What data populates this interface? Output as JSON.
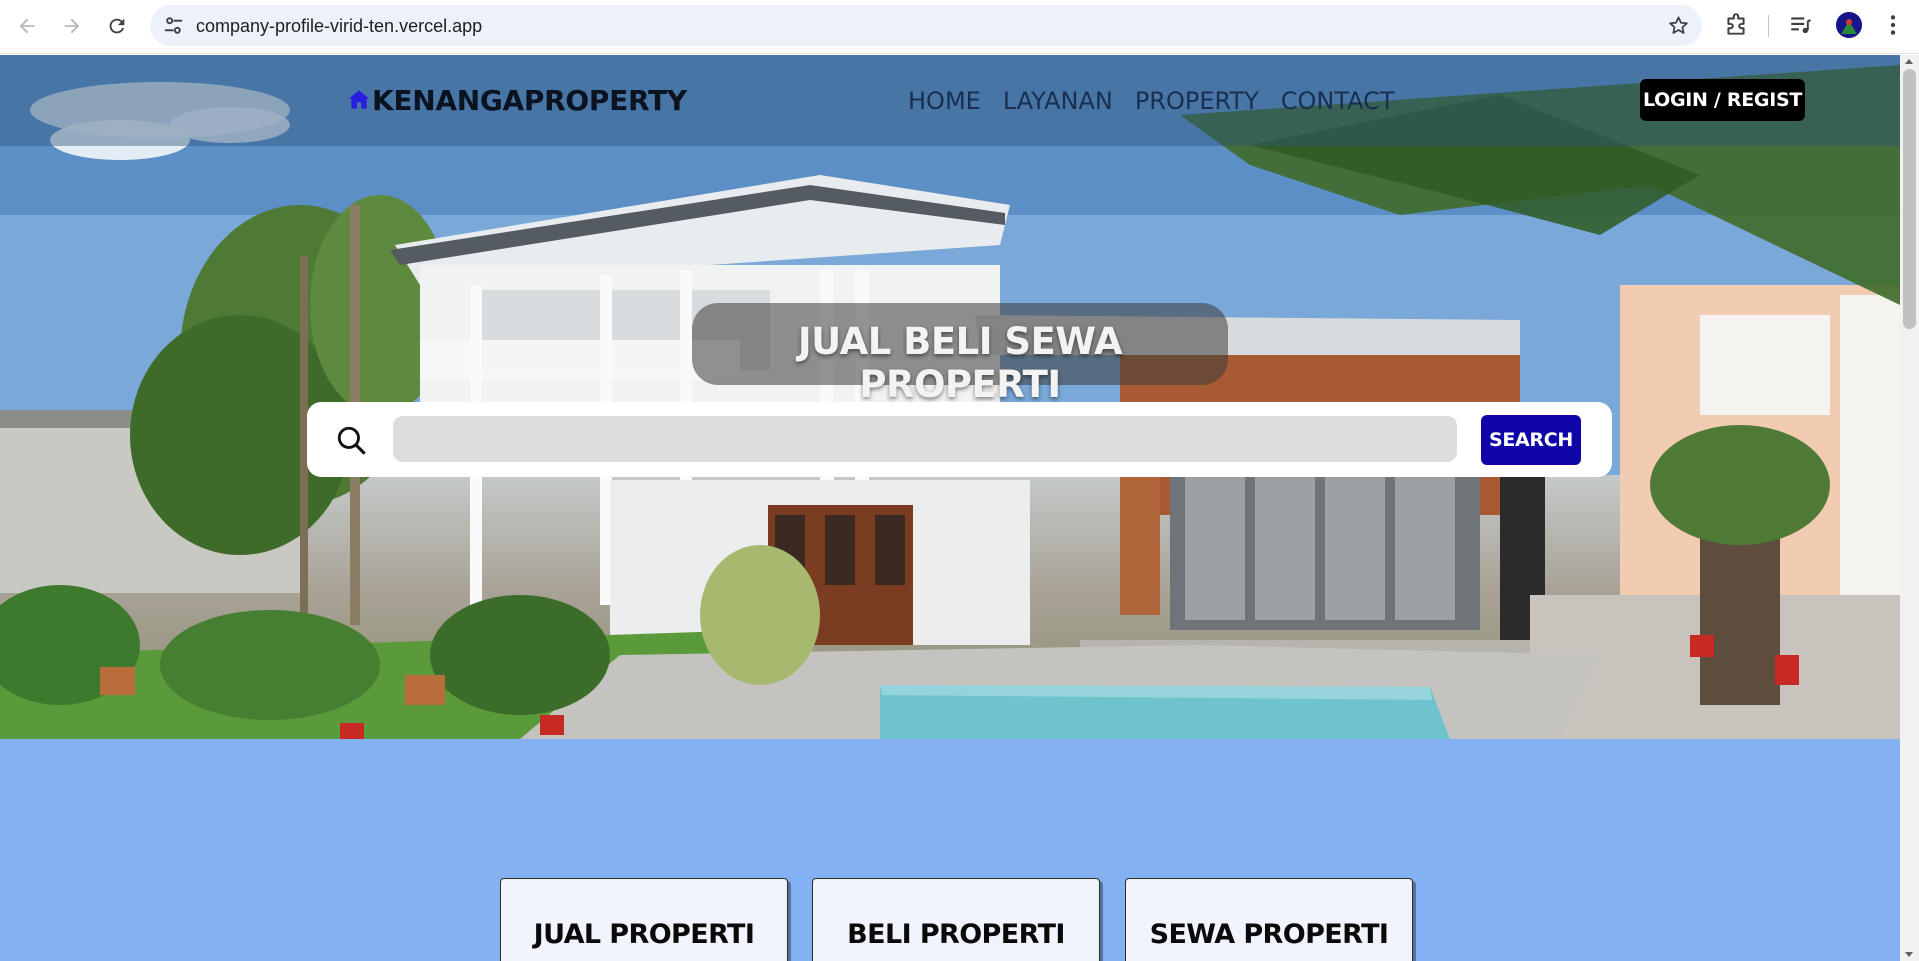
{
  "browser": {
    "url": "company-profile-virid-ten.vercel.app"
  },
  "navbar": {
    "brand": "KENANGAPROPERTY",
    "menu": [
      "HOME",
      "LAYANAN",
      "PROPERTY",
      "CONTACT"
    ],
    "login_label": "LOGIN / REGIST"
  },
  "hero": {
    "title": "JUAL BELI SEWA PROPERTI",
    "search_placeholder": "",
    "search_button": "SEARCH"
  },
  "services": [
    {
      "label": "JUAL PROPERTI"
    },
    {
      "label": "BELI PROPERTI"
    },
    {
      "label": "SEWA PROPERTI"
    }
  ],
  "colors": {
    "navbar_overlay": "#28507a",
    "search_button": "#1005a6",
    "login_button": "#000000",
    "services_bg": "#83b1f2",
    "card_bg": "#f1f4fc"
  },
  "icons": {
    "back": "arrow-left-icon",
    "forward": "arrow-right-icon",
    "reload": "reload-icon",
    "site_info": "tune-icon",
    "bookmark": "star-icon",
    "extensions": "puzzle-icon",
    "media": "media-queue-icon",
    "menu": "kebab-menu-icon",
    "brand": "home-icon",
    "search": "search-icon"
  }
}
